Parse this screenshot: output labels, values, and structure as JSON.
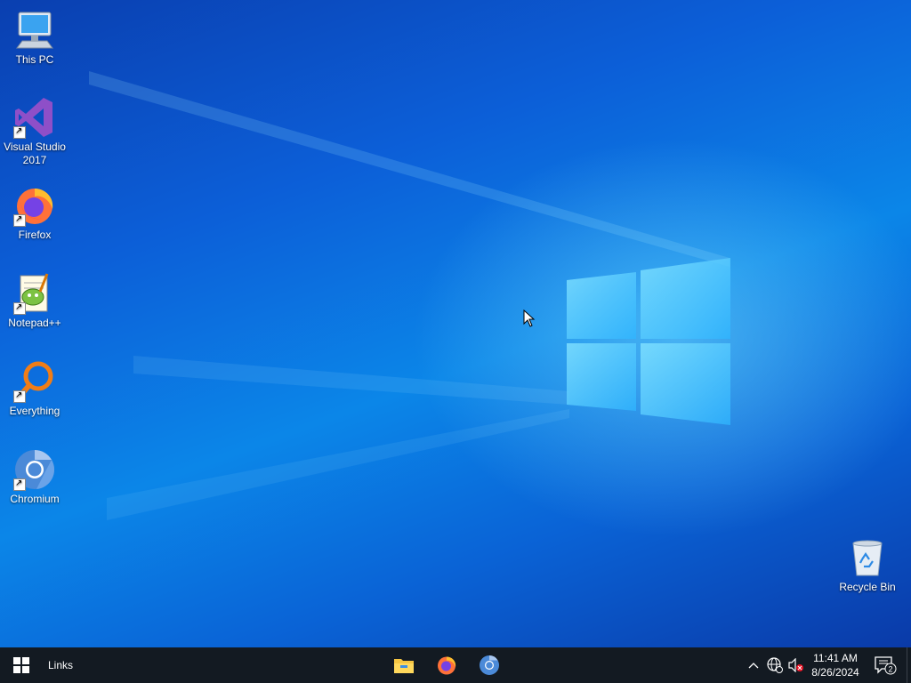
{
  "desktop": {
    "icons": [
      {
        "label": "This PC",
        "icon": "this-pc-icon"
      },
      {
        "label": "Visual Studio 2017",
        "icon": "visual-studio-icon"
      },
      {
        "label": "Firefox",
        "icon": "firefox-icon"
      },
      {
        "label": "Notepad++",
        "icon": "notepad-plus-plus-icon"
      },
      {
        "label": "Everything",
        "icon": "everything-search-icon"
      },
      {
        "label": "Chromium",
        "icon": "chromium-icon"
      },
      {
        "label": "Recycle Bin",
        "icon": "recycle-bin-icon"
      }
    ]
  },
  "taskbar": {
    "start_icon": "windows-logo-icon",
    "links_label": "Links",
    "pinned": [
      {
        "name": "File Explorer",
        "icon": "file-explorer-icon"
      },
      {
        "name": "Firefox",
        "icon": "firefox-icon"
      },
      {
        "name": "Chromium",
        "icon": "chromium-icon"
      }
    ],
    "tray": {
      "time": "11:41 AM",
      "date": "8/26/2024",
      "notification_count": "2"
    }
  },
  "colors": {
    "taskbar_bg": "#131a22",
    "desktop_accent": "#0b86e8"
  }
}
